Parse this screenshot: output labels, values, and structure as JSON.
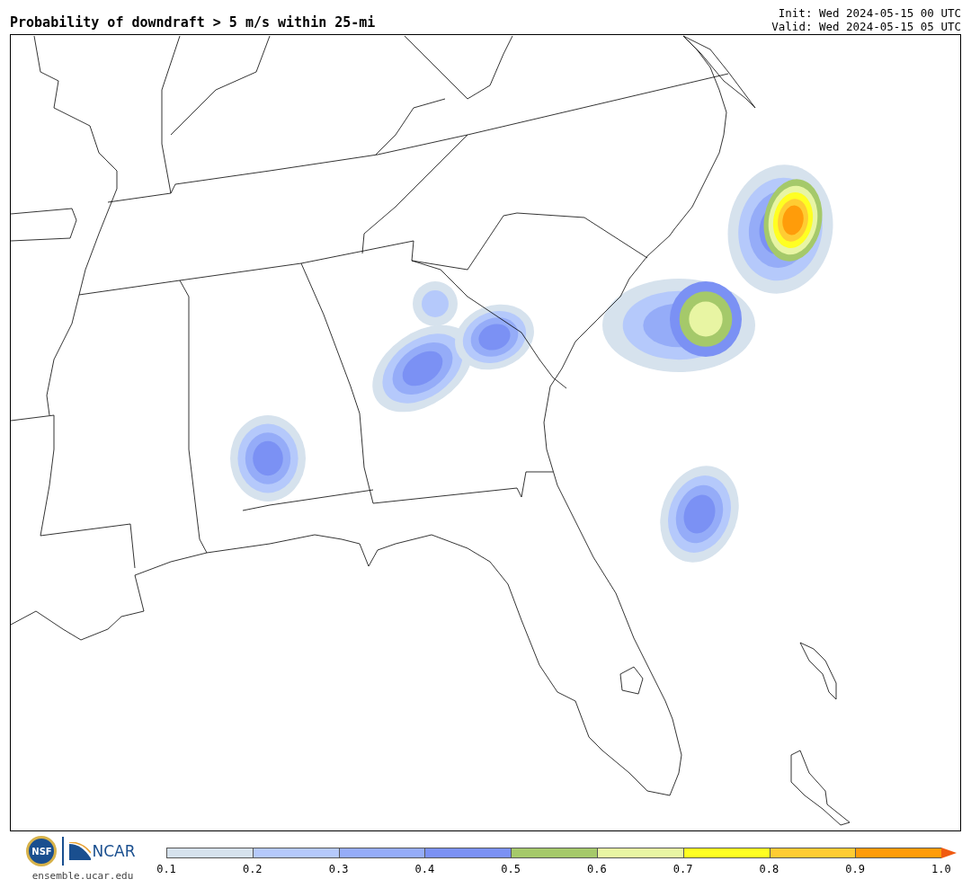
{
  "header": {
    "title": "Probability of downdraft > 5 m/s within 25-mi",
    "init": "Init: Wed 2024-05-15 00 UTC",
    "valid": "Valid: Wed 2024-05-15 05 UTC"
  },
  "footer": {
    "logos": [
      "NSF",
      "NCAR"
    ],
    "website": "ensemble.ucar.edu"
  },
  "colorbar": {
    "bins": [
      {
        "color": "#d6e2ed"
      },
      {
        "color": "#b5c9fb"
      },
      {
        "color": "#95acf8"
      },
      {
        "color": "#7b91f4"
      },
      {
        "color": "#a5c96a"
      },
      {
        "color": "#e8f5a3"
      },
      {
        "color": "#ffff22"
      },
      {
        "color": "#ffcc33"
      },
      {
        "color": "#ff9c0a"
      }
    ],
    "extend": {
      "color": "#f05a10"
    },
    "ticks": [
      "0.1",
      "0.2",
      "0.3",
      "0.4",
      "0.5",
      "0.6",
      "0.7",
      "0.8",
      "0.9",
      "1.0"
    ]
  }
}
